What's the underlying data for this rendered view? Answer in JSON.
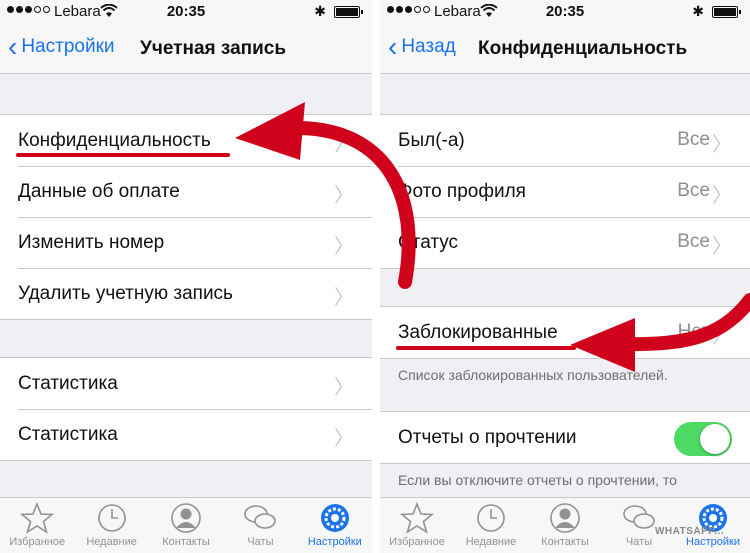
{
  "status_bar": {
    "carrier": "Lebara",
    "time": "20:35"
  },
  "left": {
    "nav": {
      "back_label": "Настройки",
      "title": "Учетная запись"
    },
    "group1": [
      {
        "label": "Конфиденциальность"
      },
      {
        "label": "Данные об оплате"
      },
      {
        "label": "Изменить номер"
      },
      {
        "label": "Удалить учетную запись"
      }
    ],
    "group2": [
      {
        "label": "Статистика"
      },
      {
        "label": "Статистика"
      }
    ]
  },
  "right": {
    "nav": {
      "back_label": "Назад",
      "title": "Конфиденциальность"
    },
    "group1": [
      {
        "label": "Был(-а)",
        "value": "Все"
      },
      {
        "label": "Фото профиля",
        "value": "Все"
      },
      {
        "label": "Статус",
        "value": "Все"
      }
    ],
    "blocked": {
      "label": "Заблокированные",
      "value": "Нет"
    },
    "blocked_footnote": "Список заблокированных пользователей.",
    "read_receipts": {
      "label": "Отчеты о прочтении",
      "enabled": true
    },
    "read_receipts_footnote": "Если вы отключите отчеты о прочтении, то"
  },
  "tabs": [
    {
      "label": "Избранное",
      "icon": "star-icon"
    },
    {
      "label": "Недавние",
      "icon": "clock-icon"
    },
    {
      "label": "Контакты",
      "icon": "contact-icon"
    },
    {
      "label": "Чаты",
      "icon": "chat-bubbles-icon"
    },
    {
      "label": "Настройки",
      "icon": "gear-icon",
      "active": true
    }
  ],
  "watermark": "WHATSAPP...",
  "colors": {
    "accent": "#1a73e8",
    "toggle_on": "#4cd964",
    "annotation": "#d0021b"
  }
}
